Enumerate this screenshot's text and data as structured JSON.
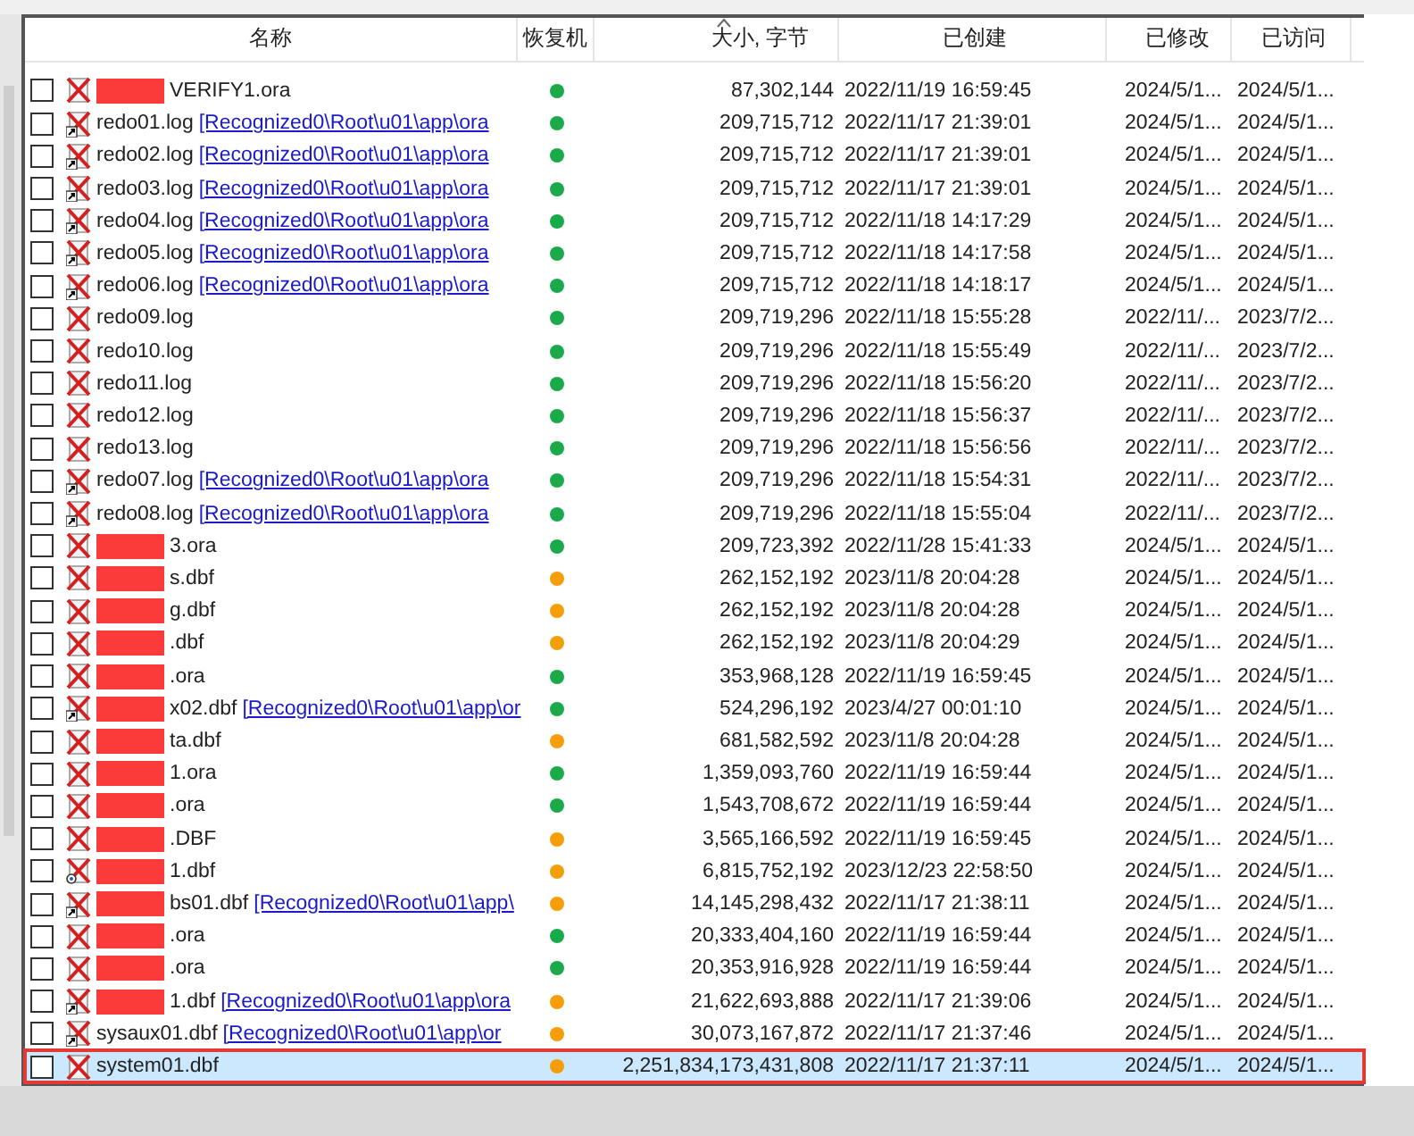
{
  "table": {
    "columns": [
      {
        "label": "名称",
        "sorted": false
      },
      {
        "label": "恢复机",
        "sorted": false
      },
      {
        "label": "大小, 字节",
        "sorted": true
      },
      {
        "label": "已创建",
        "sorted": false
      },
      {
        "label": "已修改",
        "sorted": false
      },
      {
        "label": "已访问",
        "sorted": false
      }
    ],
    "rows": [
      {
        "checked": false,
        "kind": "deleted",
        "redacted": true,
        "name": "VERIFY1.ora",
        "color": "#1aaa4a",
        "size": "87,302,144",
        "created": "2022/11/19 16:59:45",
        "modified": "2024/5/1...",
        "accessed": "2024/5/1...",
        "selected": false
      },
      {
        "checked": false,
        "kind": "shortcut",
        "redacted": false,
        "name": "redo01.log",
        "path": "[Recognized0\\Root\\u01\\app\\ora",
        "color": "#1aaa4a",
        "size": "209,715,712",
        "created": "2022/11/17 21:39:01",
        "modified": "2024/5/1...",
        "accessed": "2024/5/1...",
        "selected": false
      },
      {
        "checked": false,
        "kind": "shortcut",
        "redacted": false,
        "name": "redo02.log",
        "path": "[Recognized0\\Root\\u01\\app\\ora",
        "color": "#1aaa4a",
        "size": "209,715,712",
        "created": "2022/11/17 21:39:01",
        "modified": "2024/5/1...",
        "accessed": "2024/5/1...",
        "selected": false
      },
      {
        "checked": false,
        "kind": "shortcut",
        "redacted": false,
        "name": "redo03.log",
        "path": "[Recognized0\\Root\\u01\\app\\ora",
        "color": "#1aaa4a",
        "size": "209,715,712",
        "created": "2022/11/17 21:39:01",
        "modified": "2024/5/1...",
        "accessed": "2024/5/1...",
        "selected": false
      },
      {
        "checked": false,
        "kind": "shortcut",
        "redacted": false,
        "name": "redo04.log",
        "path": "[Recognized0\\Root\\u01\\app\\ora",
        "color": "#1aaa4a",
        "size": "209,715,712",
        "created": "2022/11/18 14:17:29",
        "modified": "2024/5/1...",
        "accessed": "2024/5/1...",
        "selected": false
      },
      {
        "checked": false,
        "kind": "shortcut",
        "redacted": false,
        "name": "redo05.log",
        "path": "[Recognized0\\Root\\u01\\app\\ora",
        "color": "#1aaa4a",
        "size": "209,715,712",
        "created": "2022/11/18 14:17:58",
        "modified": "2024/5/1...",
        "accessed": "2024/5/1...",
        "selected": false
      },
      {
        "checked": false,
        "kind": "shortcut",
        "redacted": false,
        "name": "redo06.log",
        "path": "[Recognized0\\Root\\u01\\app\\ora",
        "color": "#1aaa4a",
        "size": "209,715,712",
        "created": "2022/11/18 14:18:17",
        "modified": "2024/5/1...",
        "accessed": "2024/5/1...",
        "selected": false
      },
      {
        "checked": false,
        "kind": "deleted",
        "redacted": false,
        "name": "redo09.log",
        "color": "#1aaa4a",
        "size": "209,719,296",
        "created": "2022/11/18 15:55:28",
        "modified": "2022/11/...",
        "accessed": "2023/7/2...",
        "selected": false
      },
      {
        "checked": false,
        "kind": "deleted",
        "redacted": false,
        "name": "redo10.log",
        "color": "#1aaa4a",
        "size": "209,719,296",
        "created": "2022/11/18 15:55:49",
        "modified": "2022/11/...",
        "accessed": "2023/7/2...",
        "selected": false
      },
      {
        "checked": false,
        "kind": "deleted",
        "redacted": false,
        "name": "redo11.log",
        "color": "#1aaa4a",
        "size": "209,719,296",
        "created": "2022/11/18 15:56:20",
        "modified": "2022/11/...",
        "accessed": "2023/7/2...",
        "selected": false
      },
      {
        "checked": false,
        "kind": "deleted",
        "redacted": false,
        "name": "redo12.log",
        "color": "#1aaa4a",
        "size": "209,719,296",
        "created": "2022/11/18 15:56:37",
        "modified": "2022/11/...",
        "accessed": "2023/7/2...",
        "selected": false
      },
      {
        "checked": false,
        "kind": "deleted",
        "redacted": false,
        "name": "redo13.log",
        "color": "#1aaa4a",
        "size": "209,719,296",
        "created": "2022/11/18 15:56:56",
        "modified": "2022/11/...",
        "accessed": "2023/7/2...",
        "selected": false
      },
      {
        "checked": false,
        "kind": "shortcut",
        "redacted": false,
        "name": "redo07.log",
        "path": "[Recognized0\\Root\\u01\\app\\ora",
        "color": "#1aaa4a",
        "size": "209,719,296",
        "created": "2022/11/18 15:54:31",
        "modified": "2022/11/...",
        "accessed": "2023/7/2...",
        "selected": false
      },
      {
        "checked": false,
        "kind": "shortcut",
        "redacted": false,
        "name": "redo08.log",
        "path": "[Recognized0\\Root\\u01\\app\\ora",
        "color": "#1aaa4a",
        "size": "209,719,296",
        "created": "2022/11/18 15:55:04",
        "modified": "2022/11/...",
        "accessed": "2023/7/2...",
        "selected": false
      },
      {
        "checked": false,
        "kind": "deleted",
        "redacted": true,
        "name": "3.ora",
        "color": "#1aaa4a",
        "size": "209,723,392",
        "created": "2022/11/28 15:41:33",
        "modified": "2024/5/1...",
        "accessed": "2024/5/1...",
        "selected": false
      },
      {
        "checked": false,
        "kind": "deleted",
        "redacted": true,
        "name": "s.dbf",
        "color": "#f59e0b",
        "size": "262,152,192",
        "created": "2023/11/8 20:04:28",
        "modified": "2024/5/1...",
        "accessed": "2024/5/1...",
        "selected": false
      },
      {
        "checked": false,
        "kind": "deleted",
        "redacted": true,
        "name": "g.dbf",
        "color": "#f59e0b",
        "size": "262,152,192",
        "created": "2023/11/8 20:04:28",
        "modified": "2024/5/1...",
        "accessed": "2024/5/1...",
        "selected": false
      },
      {
        "checked": false,
        "kind": "deleted",
        "redacted": true,
        "name": ".dbf",
        "color": "#f59e0b",
        "size": "262,152,192",
        "created": "2023/11/8 20:04:29",
        "modified": "2024/5/1...",
        "accessed": "2024/5/1...",
        "selected": false
      },
      {
        "checked": false,
        "kind": "deleted",
        "redacted": true,
        "name": ".ora",
        "color": "#1aaa4a",
        "size": "353,968,128",
        "created": "2022/11/19 16:59:45",
        "modified": "2024/5/1...",
        "accessed": "2024/5/1...",
        "selected": false
      },
      {
        "checked": false,
        "kind": "shortcut",
        "redacted": true,
        "name": "x02.dbf",
        "path": "[Recognized0\\Root\\u01\\app\\or",
        "color": "#1aaa4a",
        "size": "524,296,192",
        "created": "2023/4/27 00:01:10",
        "modified": "2024/5/1...",
        "accessed": "2024/5/1...",
        "selected": false
      },
      {
        "checked": false,
        "kind": "deleted",
        "redacted": true,
        "name": "ta.dbf",
        "color": "#f59e0b",
        "size": "681,582,592",
        "created": "2023/11/8 20:04:28",
        "modified": "2024/5/1...",
        "accessed": "2024/5/1...",
        "selected": false
      },
      {
        "checked": false,
        "kind": "deleted",
        "redacted": true,
        "name": "1.ora",
        "color": "#1aaa4a",
        "size": "1,359,093,760",
        "created": "2022/11/19 16:59:44",
        "modified": "2024/5/1...",
        "accessed": "2024/5/1...",
        "selected": false
      },
      {
        "checked": false,
        "kind": "deleted",
        "redacted": true,
        "name": ".ora",
        "color": "#1aaa4a",
        "size": "1,543,708,672",
        "created": "2022/11/19 16:59:44",
        "modified": "2024/5/1...",
        "accessed": "2024/5/1...",
        "selected": false
      },
      {
        "checked": false,
        "kind": "deleted",
        "redacted": true,
        "name": ".DBF",
        "color": "#f59e0b",
        "size": "3,565,166,592",
        "created": "2022/11/19 16:59:45",
        "modified": "2024/5/1...",
        "accessed": "2024/5/1...",
        "selected": false
      },
      {
        "checked": false,
        "kind": "marked",
        "redacted": true,
        "name": "1.dbf",
        "color": "#f59e0b",
        "size": "6,815,752,192",
        "created": "2023/12/23 22:58:50",
        "modified": "2024/5/1...",
        "accessed": "2024/5/1...",
        "selected": false
      },
      {
        "checked": false,
        "kind": "shortcut",
        "redacted": true,
        "name": "bs01.dbf",
        "path": "[Recognized0\\Root\\u01\\app\\",
        "color": "#f59e0b",
        "size": "14,145,298,432",
        "created": "2022/11/17 21:38:11",
        "modified": "2024/5/1...",
        "accessed": "2024/5/1...",
        "selected": false
      },
      {
        "checked": false,
        "kind": "deleted",
        "redacted": true,
        "name": ".ora",
        "color": "#1aaa4a",
        "size": "20,333,404,160",
        "created": "2022/11/19 16:59:44",
        "modified": "2024/5/1...",
        "accessed": "2024/5/1...",
        "selected": false
      },
      {
        "checked": false,
        "kind": "deleted",
        "redacted": true,
        "name": ".ora",
        "color": "#1aaa4a",
        "size": "20,353,916,928",
        "created": "2022/11/19 16:59:44",
        "modified": "2024/5/1...",
        "accessed": "2024/5/1...",
        "selected": false
      },
      {
        "checked": false,
        "kind": "shortcut",
        "redacted": true,
        "name": "1.dbf",
        "path": "[Recognized0\\Root\\u01\\app\\ora",
        "color": "#f59e0b",
        "size": "21,622,693,888",
        "created": "2022/11/17 21:39:06",
        "modified": "2024/5/1...",
        "accessed": "2024/5/1...",
        "selected": false
      },
      {
        "checked": false,
        "kind": "shortcut",
        "redacted": false,
        "name": "sysaux01.dbf",
        "path": "[Recognized0\\Root\\u01\\app\\or",
        "color": "#f59e0b",
        "size": "30,073,167,872",
        "created": "2022/11/17 21:37:46",
        "modified": "2024/5/1...",
        "accessed": "2024/5/1...",
        "selected": false
      },
      {
        "checked": false,
        "kind": "deleted",
        "redacted": false,
        "name": "system01.dbf",
        "color": "#f59e0b",
        "size": "2,251,834,173,431,808",
        "created": "2022/11/17 21:37:11",
        "modified": "2024/5/1...",
        "accessed": "2024/5/1...",
        "selected": true
      }
    ]
  }
}
